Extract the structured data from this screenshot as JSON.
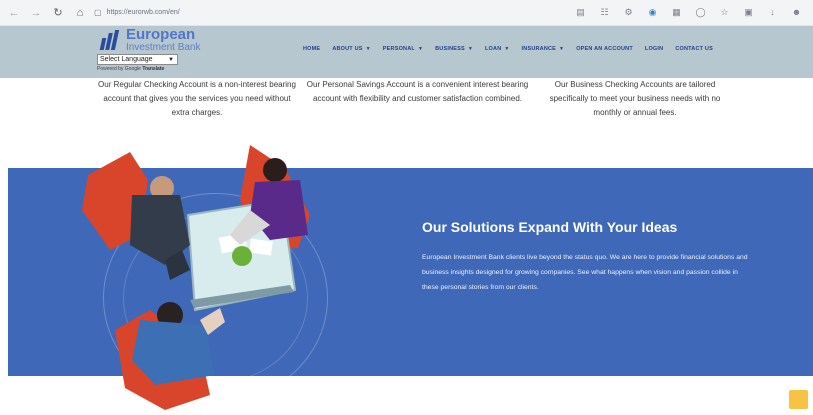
{
  "browser": {
    "url": "https://eurorwb.com/en/"
  },
  "header": {
    "logo": {
      "line1": "European",
      "line2": "Investment Bank"
    },
    "language_select": {
      "value": "Select Language"
    },
    "powered_by": {
      "prefix": "Powered by",
      "brand": "Google",
      "action": "Translate"
    },
    "nav": [
      {
        "label": "HOME",
        "dropdown": false
      },
      {
        "label": "ABOUT US",
        "dropdown": true
      },
      {
        "label": "PERSONAL",
        "dropdown": true
      },
      {
        "label": "BUSINESS",
        "dropdown": true
      },
      {
        "label": "LOAN",
        "dropdown": true
      },
      {
        "label": "INSURANCE",
        "dropdown": true
      },
      {
        "label": "OPEN AN ACCOUNT",
        "dropdown": false
      },
      {
        "label": "LOGIN",
        "dropdown": false
      },
      {
        "label": "CONTACT US",
        "dropdown": false
      }
    ]
  },
  "accounts": [
    {
      "text": "Our Regular Checking Account is a non-interest bearing account that gives you the services you need without extra charges."
    },
    {
      "text": "Our Personal Savings Account is a convenient interest bearing account with flexibility and customer satisfaction combined."
    },
    {
      "text": "Our Business Checking Accounts are tailored specifically to meet your business needs with no monthly or annual fees."
    }
  ],
  "solutions": {
    "title": "Our Solutions Expand With Your Ideas",
    "body": "European Investment Bank clients live beyond the status quo. We are here to provide financial solutions and business insights designed for growing companies. See what happens when vision and passion collide in these personal stories from our clients."
  },
  "colors": {
    "header_bg": "#b7c7cf",
    "nav_text": "#24418a",
    "band_bg": "#3f68b8",
    "chair": "#d8452b",
    "scroll_top": "#f6c344"
  }
}
